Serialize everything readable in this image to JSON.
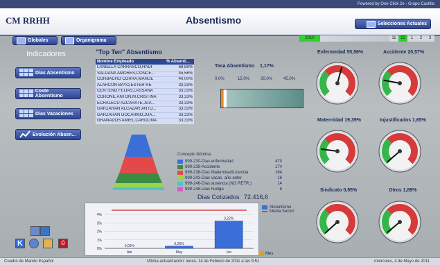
{
  "topbar": {
    "powered_by": "Powered by One Click 2e - Grupo Castilla"
  },
  "header": {
    "app_title": "CM RRHH",
    "page_title": "Absentismo",
    "selecciones_label": "Selecciones Actuales"
  },
  "nav_tabs": [
    {
      "label": "Globales"
    },
    {
      "label": "Organigrama"
    }
  ],
  "year_selector": {
    "colors": {
      "selected": "#2fd12f",
      "unselected": "#d5d8de"
    },
    "year": "2010",
    "months": [
      "11",
      "12",
      "1",
      "2",
      "3"
    ],
    "selected_months": [
      "12"
    ]
  },
  "indicadores": {
    "title": "Indicadores",
    "buttons": [
      {
        "label": "Dias Absentismo"
      },
      {
        "label": "Coste Absentismo"
      },
      {
        "label": "Dias Vacaciones"
      },
      {
        "label": "Evolución Absen..."
      }
    ]
  },
  "top_ten": {
    "title": "\"Top Ten\" Absentismo",
    "headers": [
      "Nombre Empleado",
      "% Absenti..."
    ],
    "rows": [
      {
        "name": "LANIELLA CARRASCO,HADI",
        "pct": "68,89%"
      },
      {
        "name": "SALDANA AMORES,CONCE...",
        "pct": "45,56%"
      },
      {
        "name": "CORBACHO CORRA,MANUE",
        "pct": "40,00%"
      },
      {
        "name": "ALARCON BAYO,ESTER RE",
        "pct": "33,33%"
      },
      {
        "name": "CENTENO FEIJAS,LASSANA",
        "pct": "33,33%"
      },
      {
        "name": "CORONIL ANTON,M.CRISTINA",
        "pct": "33,33%"
      },
      {
        "name": "ECHALECU AZCARATE,JUA...",
        "pct": "33,33%"
      },
      {
        "name": "GARZARAN ALCAZAR,ANTO...",
        "pct": "33,33%"
      },
      {
        "name": "GARZARAN DOCARMO,JUA...",
        "pct": "33,33%"
      },
      {
        "name": "GRANADOS AMIEL,CAROLINA",
        "pct": "33,33%"
      }
    ]
  },
  "tasa": {
    "title": "Tasa Absentismo",
    "value": "1,17%",
    "ticks": [
      "0,0%",
      "15,0%",
      "30,0%",
      "45,0%"
    ],
    "fill_fraction": 0.026
  },
  "concepts": {
    "title": "Concepto Nómina",
    "items": [
      {
        "label": "999-230-Dias enfermedad",
        "value": "470",
        "color": "#3a6fd8"
      },
      {
        "label": "999-239-Accidente",
        "value": "174",
        "color": "#3c8a44"
      },
      {
        "label": "999-238-Dias Maternidad/Licencia",
        "value": "164",
        "color": "#e24a4a"
      },
      {
        "label": "999-243-Dias vacac. año anter",
        "value": "16",
        "color": "#9ad64a"
      },
      {
        "label": "999-246-Dias ausencia (NO RETR.)",
        "value": "14",
        "color": "#48c6d6"
      },
      {
        "label": "999-248-Dias huelga",
        "value": "8",
        "color": "#d65ac8"
      }
    ]
  },
  "dias_cotizados": {
    "label": "Dias Cotizados",
    "value": "72.416,6"
  },
  "gauges": [
    {
      "label": "Enfermedad 55,56%",
      "value": 0.5556
    },
    {
      "label": "Accidente 20,57%",
      "value": 0.2057
    },
    {
      "label": "Maternidad 19,39%",
      "value": 0.1939
    },
    {
      "label": "Injustificados 1,65%",
      "value": 0.0165
    },
    {
      "label": "Sindicato 0,95%",
      "value": 0.0095
    },
    {
      "label": "Otros 1,89%",
      "value": 0.0189
    }
  ],
  "chart_data": {
    "type": "bar",
    "categories": [
      "Abr",
      "May",
      "Jun"
    ],
    "series": [
      {
        "name": "Absentismo",
        "values": [
          0.0,
          0.26,
          3.22
        ]
      },
      {
        "name": "Media Sector",
        "values": [
          4.5,
          4.5,
          4.5
        ]
      }
    ],
    "data_labels": [
      "0,00%",
      "0,26%",
      "3,22%"
    ],
    "yticks": [
      "0%",
      "1%",
      "2%",
      "3%",
      "4%"
    ],
    "ylim": [
      0,
      4.5
    ],
    "xlabel": "Mes",
    "colors": {
      "Absentismo": "#3a6fd8",
      "Media Sector": "#d94040"
    }
  },
  "statusbar": {
    "left": "Cuadro de Mando Español",
    "center": "Ultima actualización: lunes, 14 de Febrero de 2011 a las 9:51",
    "right": "miércoles, 4 de Mayo de 2011"
  }
}
